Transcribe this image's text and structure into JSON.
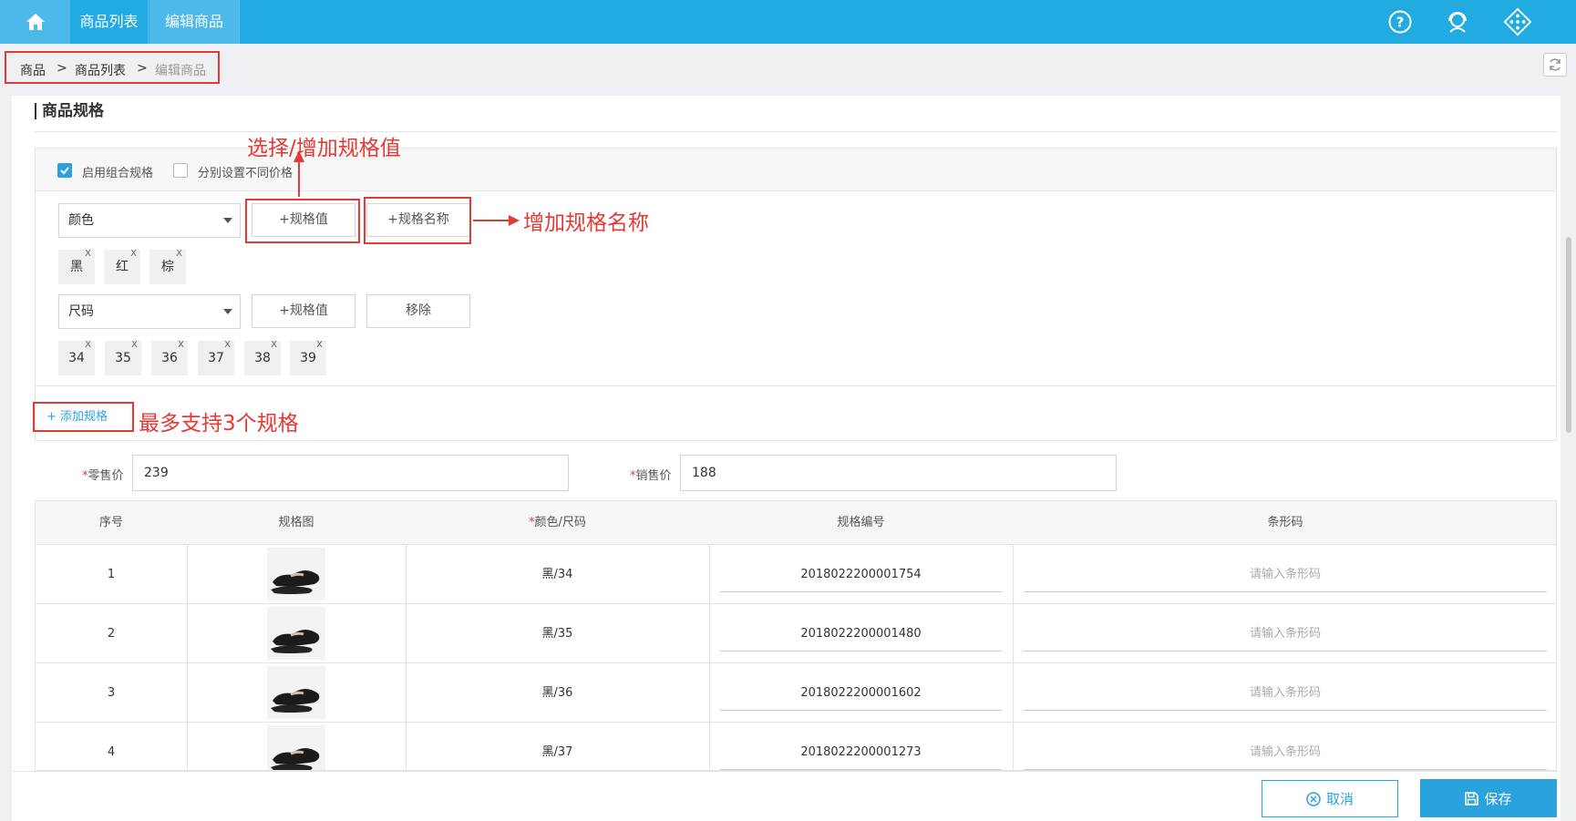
{
  "topbar": {
    "tabs": [
      "商品列表",
      "编辑商品"
    ],
    "icons": [
      "home-icon",
      "help-icon",
      "support-icon",
      "apps-icon"
    ]
  },
  "breadcrumb": {
    "items": [
      "商品",
      "商品列表",
      "编辑商品"
    ],
    "separator": ">"
  },
  "section": {
    "title": "商品规格"
  },
  "spec_panel": {
    "enable_combo_label": "启用组合规格",
    "enable_combo_checked": true,
    "separate_price_label": "分别设置不同价格",
    "separate_price_checked": false,
    "specs": [
      {
        "name": "颜色",
        "add_value_label": "+规格值",
        "second_button_label": "+规格名称",
        "values": [
          "黑",
          "红",
          "棕"
        ]
      },
      {
        "name": "尺码",
        "add_value_label": "+规格值",
        "second_button_label": "移除",
        "values": [
          "34",
          "35",
          "36",
          "37",
          "38",
          "39"
        ]
      }
    ],
    "tag_remove": "X",
    "add_spec_label": "+ 添加规格"
  },
  "annotations": {
    "select_add_value": "选择/增加规格值",
    "add_spec_name": "增加规格名称",
    "max_specs": "最多支持3个规格"
  },
  "prices": {
    "retail_label": "零售价",
    "retail_value": "239",
    "sale_label": "销售价",
    "sale_value": "188",
    "required_mark": "*"
  },
  "table": {
    "headers": [
      "序号",
      "规格图",
      "颜色/尺码",
      "规格编号",
      "条形码"
    ],
    "barcode_placeholder": "请输入条形码",
    "rows": [
      {
        "index": "1",
        "spec": "黑/34",
        "code": "2018022200001754"
      },
      {
        "index": "2",
        "spec": "黑/35",
        "code": "2018022200001480"
      },
      {
        "index": "3",
        "spec": "黑/36",
        "code": "2018022200001602"
      },
      {
        "index": "4",
        "spec": "黑/37",
        "code": "2018022200001273"
      }
    ]
  },
  "footer": {
    "cancel_label": "取消",
    "save_label": "保存"
  },
  "colors": {
    "accent": "#22aae3",
    "annotation": "#e53935"
  }
}
